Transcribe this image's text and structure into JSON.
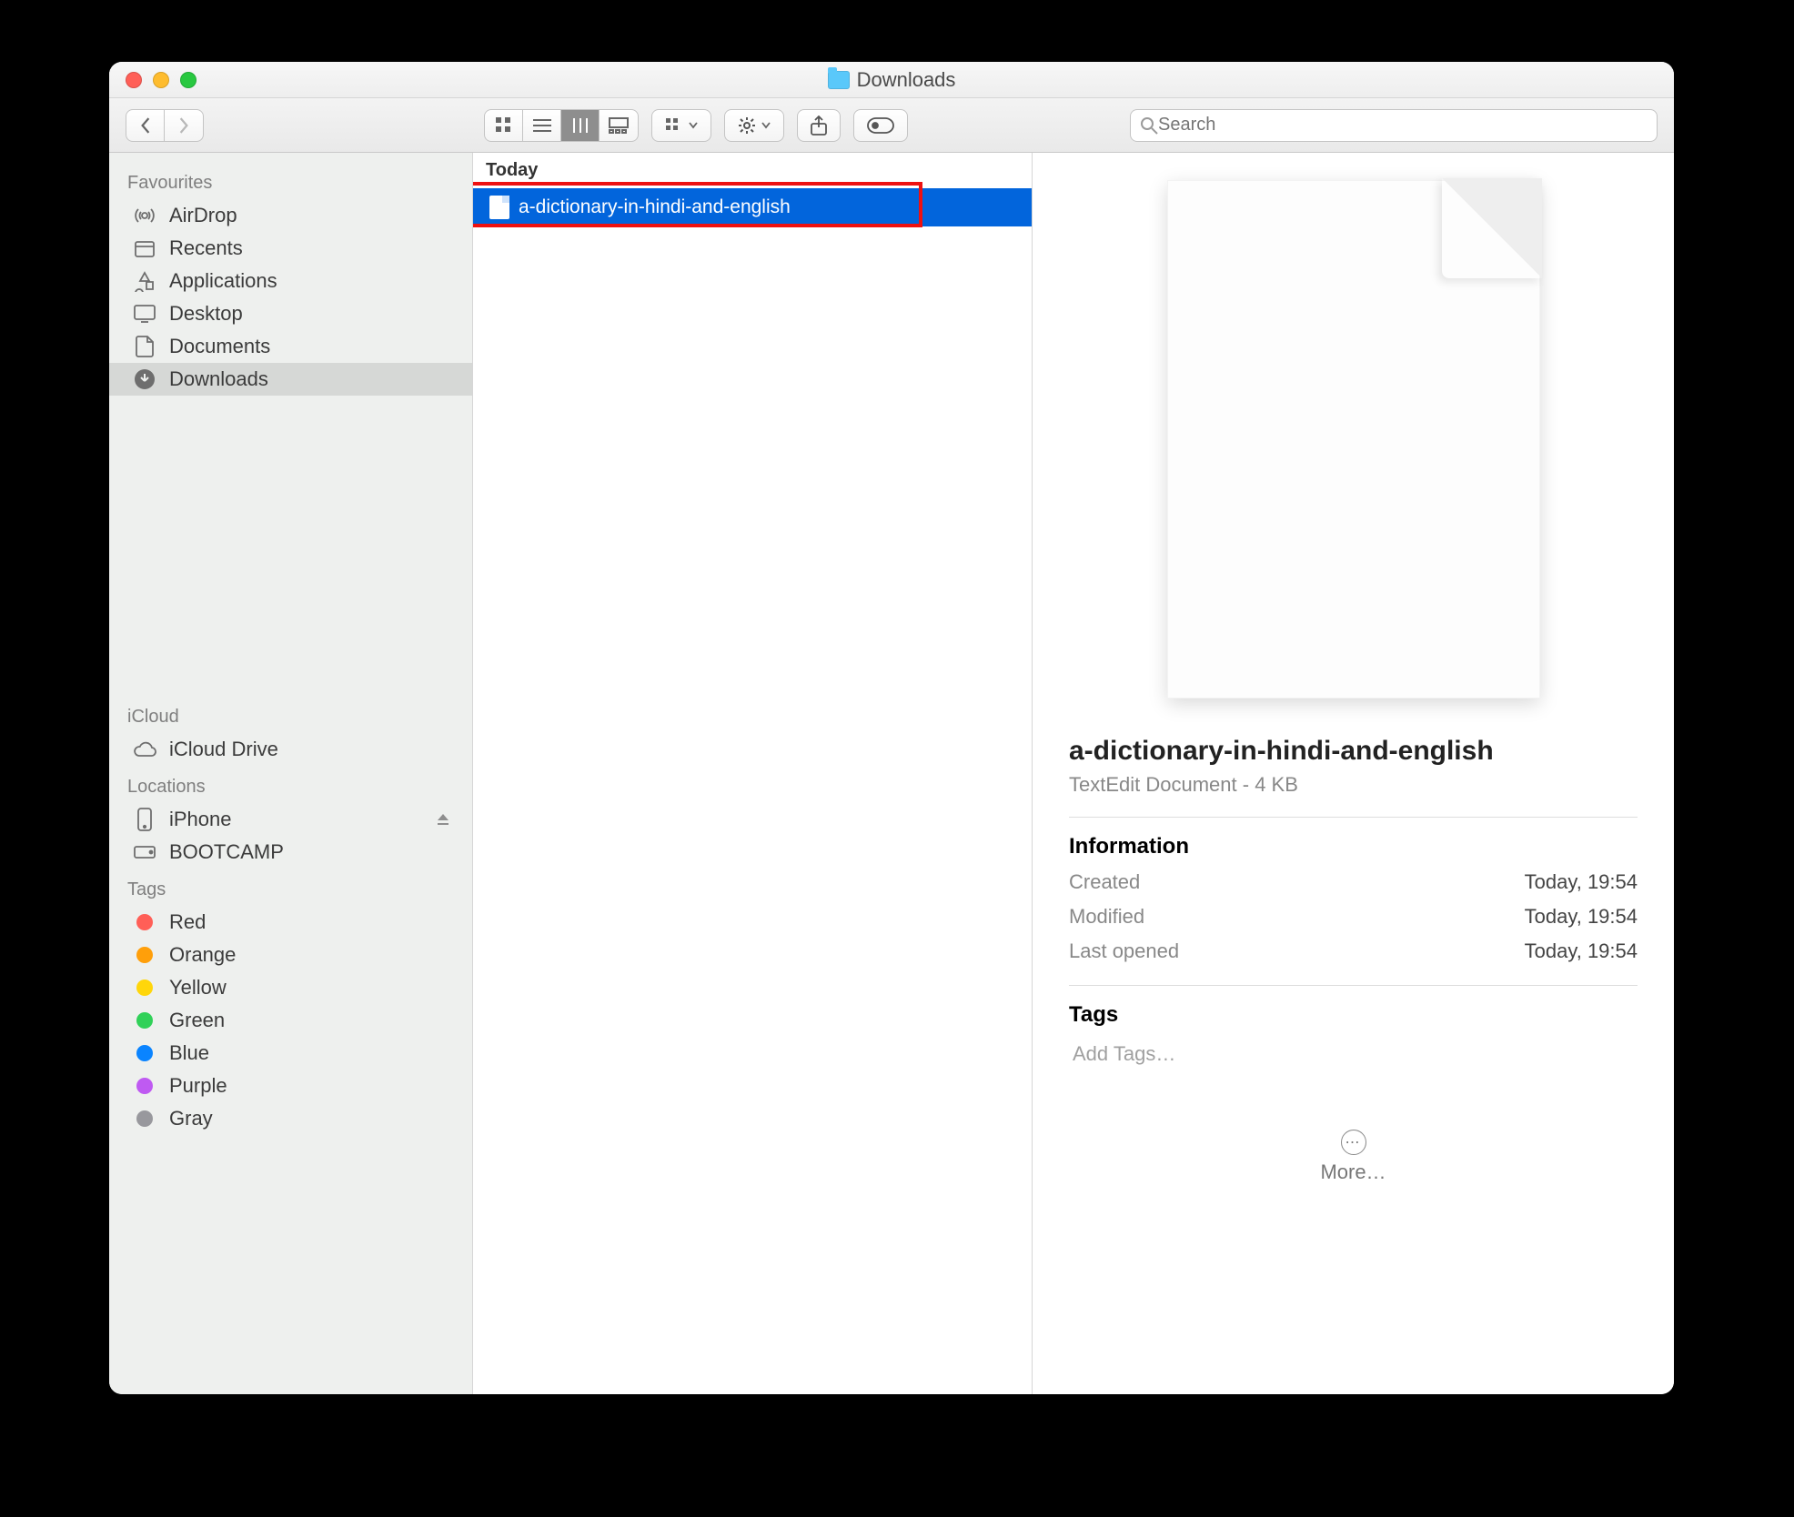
{
  "window": {
    "title": "Downloads"
  },
  "toolbar": {
    "search_placeholder": "Search"
  },
  "sidebar": {
    "favourites_label": "Favourites",
    "favourites": [
      {
        "label": "AirDrop"
      },
      {
        "label": "Recents"
      },
      {
        "label": "Applications"
      },
      {
        "label": "Desktop"
      },
      {
        "label": "Documents"
      },
      {
        "label": "Downloads",
        "selected": true
      }
    ],
    "icloud_label": "iCloud",
    "icloud": [
      {
        "label": "iCloud Drive"
      }
    ],
    "locations_label": "Locations",
    "locations": [
      {
        "label": "iPhone",
        "ejectable": true
      },
      {
        "label": "BOOTCAMP"
      }
    ],
    "tags_label": "Tags",
    "tags": [
      {
        "label": "Red",
        "color": "#ff5f57"
      },
      {
        "label": "Orange",
        "color": "#ff9f0a"
      },
      {
        "label": "Yellow",
        "color": "#ffd60a"
      },
      {
        "label": "Green",
        "color": "#30d158"
      },
      {
        "label": "Blue",
        "color": "#0a84ff"
      },
      {
        "label": "Purple",
        "color": "#bf5af2"
      },
      {
        "label": "Gray",
        "color": "#98989d"
      }
    ]
  },
  "filelist": {
    "group_label": "Today",
    "items": [
      {
        "name": "a-dictionary-in-hindi-and-english",
        "selected": true
      }
    ]
  },
  "preview": {
    "name": "a-dictionary-in-hindi-and-english",
    "subtitle": "TextEdit Document - 4 KB",
    "info_label": "Information",
    "rows": [
      {
        "k": "Created",
        "v": "Today, 19:54"
      },
      {
        "k": "Modified",
        "v": "Today, 19:54"
      },
      {
        "k": "Last opened",
        "v": "Today, 19:54"
      }
    ],
    "tags_label": "Tags",
    "add_tags_placeholder": "Add Tags…",
    "more_label": "More…"
  }
}
